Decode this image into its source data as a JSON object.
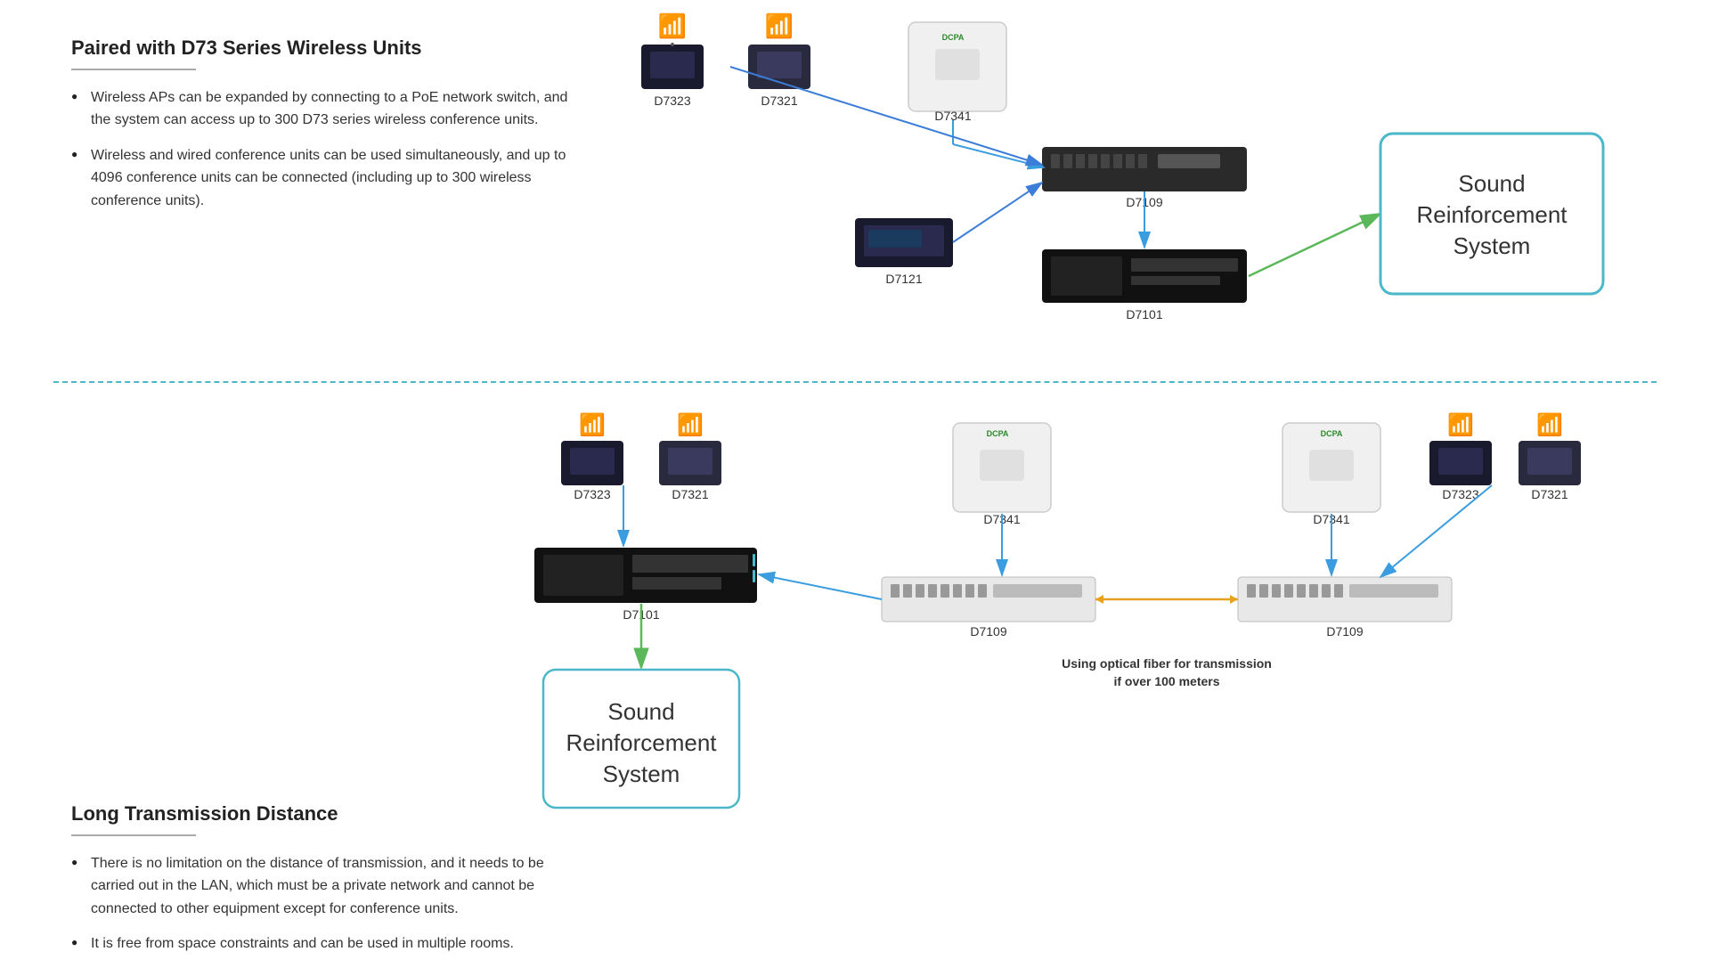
{
  "top": {
    "title": "Paired with D73 Series Wireless Units",
    "bullets": [
      "Wireless APs can be expanded by connecting to a PoE network switch, and the system can access up to 300 D73 series wireless conference units.",
      "Wireless and wired conference units can be used simultaneously, and up to 4096 conference units can be connected (including up to 300 wireless conference units)."
    ]
  },
  "bottom": {
    "title": "Long Transmission Distance",
    "bullets": [
      "There is no limitation on the distance of transmission, and it needs to be carried out in the LAN, which must be a private network and cannot be connected to other equipment except for conference units.",
      "It is free from space constraints and can be used in multiple rooms."
    ]
  },
  "devices": {
    "D7323": "D7323",
    "D7321": "D7321",
    "D7341": "D7341",
    "D7109": "D7109",
    "D7101": "D7101",
    "D7121": "D7121"
  },
  "sound_box_text": "Sound\nReinforcement\nSystem",
  "fiber_label": "Using optical fiber for transmission\nif over 100 meters",
  "colors": {
    "blue_arrow": "#3b7dd8",
    "green_arrow": "#5ab85a",
    "orange_line": "#e8a020",
    "teal_box": "#4ab8c8"
  }
}
